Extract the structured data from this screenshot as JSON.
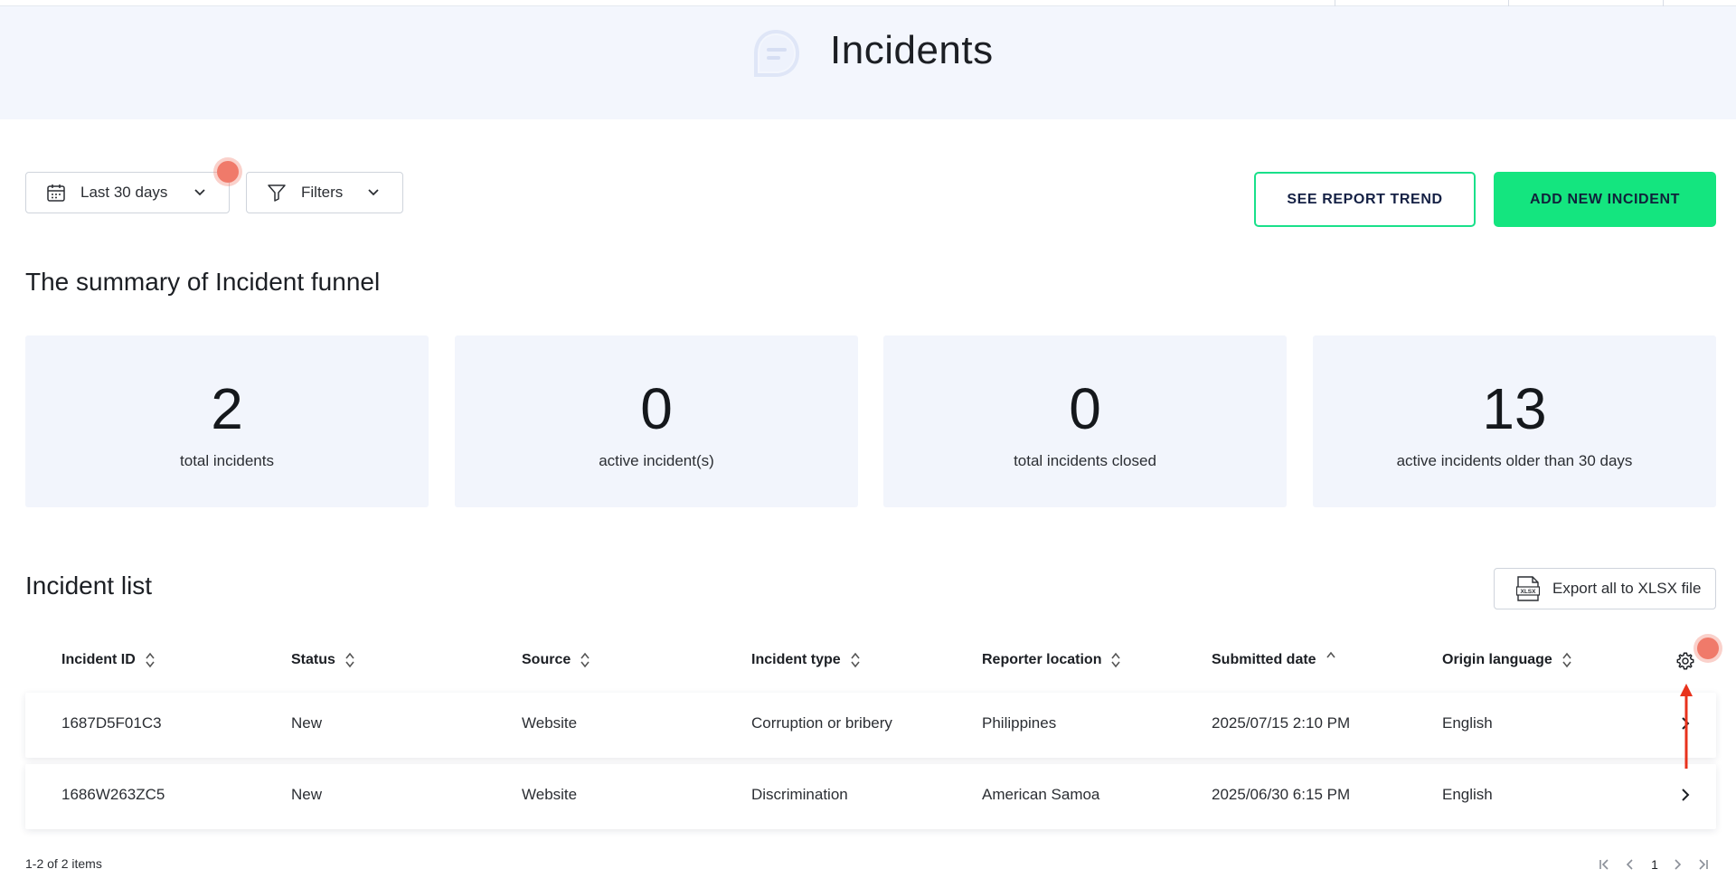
{
  "header": {
    "title": "Incidents"
  },
  "toolbar": {
    "date_range": "Last 30 days",
    "filters_label": "Filters",
    "see_report_trend": "SEE REPORT TREND",
    "add_new_incident": "ADD NEW INCIDENT"
  },
  "summary": {
    "title": "The summary of Incident funnel",
    "cards": [
      {
        "value": "2",
        "label": "total incidents"
      },
      {
        "value": "0",
        "label": "active incident(s)"
      },
      {
        "value": "0",
        "label": "total incidents closed"
      },
      {
        "value": "13",
        "label": "active incidents older than 30 days"
      }
    ]
  },
  "list": {
    "title": "Incident list",
    "export_label": "Export all to XLSX file",
    "export_icon_text": "XLSX",
    "columns": [
      "Incident ID",
      "Status",
      "Source",
      "Incident type",
      "Reporter location",
      "Submitted date",
      "Origin language"
    ],
    "rows": [
      [
        "1687D5F01C3",
        "New",
        "Website",
        "Corruption or bribery",
        "Philippines",
        "2025/07/15 2:10 PM",
        "English"
      ],
      [
        "1686W263ZC5",
        "New",
        "Website",
        "Discrimination",
        "American Samoa",
        "2025/06/30 6:15 PM",
        "English"
      ]
    ]
  },
  "pagination": {
    "summary": "1-2 of 2 items",
    "current_page": "1"
  },
  "colors": {
    "accent_green": "#14e57f",
    "header_bg": "#f3f6fd",
    "card_bg": "#f2f5fc",
    "highlight_dot": "#f07a6a",
    "annotation_arrow": "#e8321c"
  }
}
